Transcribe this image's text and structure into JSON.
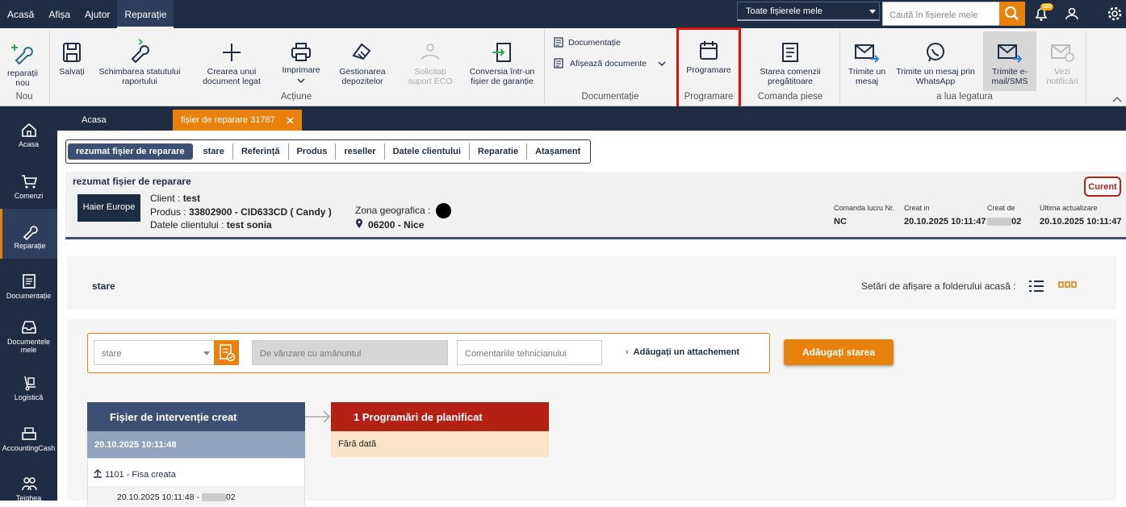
{
  "topbar": {
    "menu": [
      "Acasă",
      "Afișa",
      "Ajutor",
      "Reparație"
    ],
    "file_select": "Toate fișierele mele",
    "search_placeholder": "Caută în fișierele mele",
    "notification_badge": "100"
  },
  "ribbon": {
    "new_repair": "reparații nou",
    "grp_nou": "Nou",
    "save": "Salvați",
    "change_status": "Schimbarea statutului raportului",
    "create_doc": "Crearea unui document legat",
    "print": "Imprimare",
    "deposits": "Gestionarea depozitelor",
    "eco": "Solicitați suport ECO",
    "convert": "Conversia într-un fișier de garanție",
    "grp_actiune": "Acțiune",
    "documentatie": "Documentație",
    "show_docs": "Afișează documente",
    "grp_documentatie": "Documentație",
    "programare": "Programare",
    "grp_programare": "Programare",
    "parts_status": "Starea comenzii pregătitoare",
    "grp_piese": "Comanda piese",
    "send_msg": "Trimite un mesaj",
    "send_whatsapp": "Trimite un mesaj prin WhatsApp",
    "send_email": "Trimite e-mail/SMS",
    "view_notif": "Vezi notificări",
    "grp_contact": "a lua legatura"
  },
  "sidebar": [
    "Acasa",
    "Comenzi",
    "Reparație",
    "Documentație",
    "Documentele mele",
    "Logistică",
    "AccountingCash",
    "Tejghea"
  ],
  "tabs": {
    "home": "Acasa",
    "file": "fișier de reparare 31787"
  },
  "subtabs": [
    "rezumat fișier de reparare",
    "stare",
    "Referință",
    "Produs",
    "reseller",
    "Datele clientului",
    "Reparatie",
    "Atașament"
  ],
  "summary": {
    "title": "rezumat fișier de reparare",
    "logo": "Haier Europe",
    "client_label": "Client : ",
    "client": "test",
    "product_label": "Produs : ",
    "product": "33802900 - CID633CD ( Candy )",
    "customer_label": "Datele clientului : ",
    "customer": "test sonia",
    "zone_label": "Zona geografica :",
    "location": "06200 - Nice",
    "status": "Curent",
    "order_label": "Comanda lucru Nr.",
    "order_value": "NC",
    "created_label": "Creat in",
    "created_value": "20.10.2025 10:11:47",
    "created_by_label": "Creat de",
    "created_by_suffix": "02",
    "updated_label": "Ultima actualizare",
    "updated_value": "20.10.2025 10:11:47"
  },
  "stare": {
    "title": "stare",
    "display_settings": "Setări de afișare a folderului acasă :"
  },
  "form": {
    "status_select": "stare",
    "sale_placeholder": "De vânzare cu amănuntul",
    "comment_placeholder": "Comentariile tehnicianului",
    "attach": "Adăugați un attachement",
    "add_button": "Adăugați starea"
  },
  "timeline": {
    "card1_title": "Fișier de intervenție creat",
    "card1_date": "20.10.2025 10:11:48",
    "card1_item": "1101 - Fisa creata",
    "card1_item_date": "20.10.2025 10:11:48  -",
    "card1_item_suffix": "02",
    "card2_title": "1 Programări de planificat",
    "card2_body": "Fără dată"
  },
  "colors": {
    "navy": "#1f2d44",
    "orange": "#e8820c",
    "red": "#b52014",
    "highlight": "#e01010"
  }
}
